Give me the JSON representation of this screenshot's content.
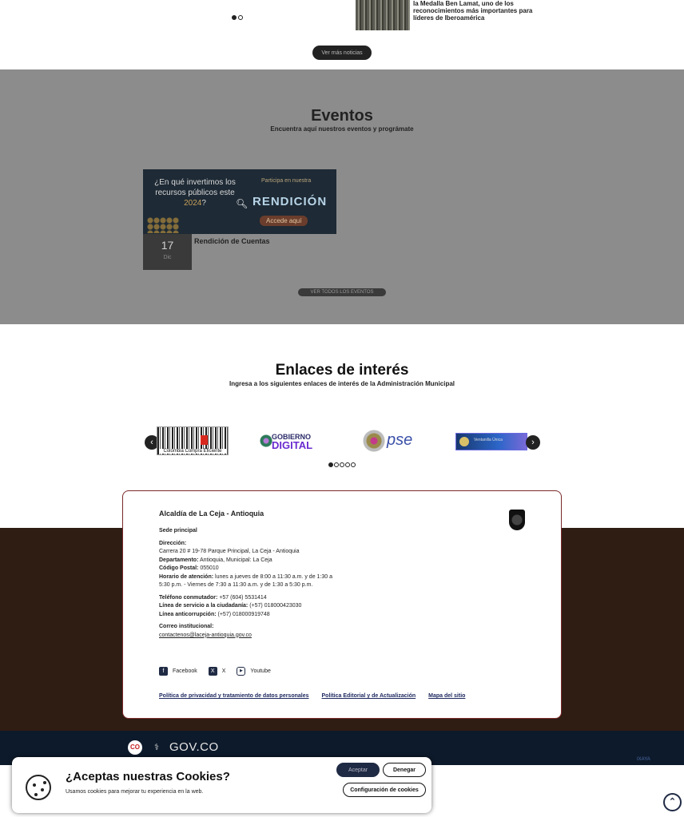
{
  "news": {
    "headline": "la Medalla Ben Lamat, uno de los reconocimientos más importantes para líderes de Iberoamérica",
    "more_button": "Ver más noticias"
  },
  "events": {
    "title": "Eventos",
    "subtitle": "Encuentra aquí nuestros eventos y prográmate",
    "banner": {
      "question_start": "¿En qué invertimos los recursos públicos este ",
      "question_year": "2024",
      "question_end": "?",
      "participa": "Participa en nuestra",
      "rendicion": "RENDICIÓN",
      "accede": "Accede aquí"
    },
    "item": {
      "day": "17",
      "month": "Dic",
      "name": "Rendición de Cuentas"
    },
    "all_button": "VER TODOS LOS EVENTOS"
  },
  "links": {
    "title": "Enlaces de interés",
    "subtitle": "Ingresa a los siguientes enlaces de interés de la Administración Municipal",
    "logos": [
      {
        "caption": "Colombia Compra Eficiente"
      },
      {
        "line1": "GOBIERNO",
        "line2": "DIGITAL"
      },
      {
        "text": "pse"
      },
      {
        "text": "Ventanilla Única"
      }
    ],
    "prev_arrow": "‹",
    "next_arrow": "›"
  },
  "footer": {
    "title": "Alcaldía de La Ceja - Antioquia",
    "sede": "Sede principal",
    "direccion_label": "Dirección:",
    "direccion": "Carrera 20 # 19-78 Parque Principal, La Ceja - Antioquia",
    "departamento_label": "Departamento:",
    "departamento": " Antioquia, Municipal: La Ceja",
    "postal_label": "Código Postal:",
    "postal": " 055010",
    "horario_label": "Horario de atención:",
    "horario": " lunes a jueves de 8:00 a 11:30 a.m. y de 1:30 a 5:30 p.m. - Viernes de 7:30 a 11:30 a.m. y de 1:30 a 5:30 p.m.",
    "telefono_label": "Teléfono conmutador:",
    "telefono": " +57 (604) 5531414",
    "linea_ciudadania_label": "Línea de servicio a la ciudadanía:",
    "linea_ciudadania": " (+57) 018000423030",
    "linea_anticorrupcion_label": "Línea anticorrupción:",
    "linea_anticorrupcion": " (+57) 018000919748",
    "correo_label": "Correo institucional:",
    "correo": "contactenos@laceja-antioquia.gov.co",
    "social": [
      {
        "icon": "f",
        "label": "Facebook"
      },
      {
        "icon": "X",
        "label": "X"
      },
      {
        "icon": "▶",
        "label": "Youtube"
      }
    ],
    "policies": [
      "Política de privacidad y tratamiento de datos personales",
      "Política Editorial y de Actualización",
      "Mapa del sitio"
    ]
  },
  "govbar": {
    "co": "CO",
    "govco": "GOV.CO",
    "credit": "IXAYA"
  },
  "cookie": {
    "title": "¿Aceptas nuestras Cookies?",
    "text": "Usamos cookies para mejorar tu experiencia en la web.",
    "accept": "Aceptar",
    "deny": "Denegar",
    "config": "Configuración de cookies"
  },
  "colors": {
    "events_bg": "#8c8c8c",
    "footer_dark": "#2f1c13",
    "govbar": "#0d1a2b",
    "accent_navy": "#1f2a44"
  }
}
